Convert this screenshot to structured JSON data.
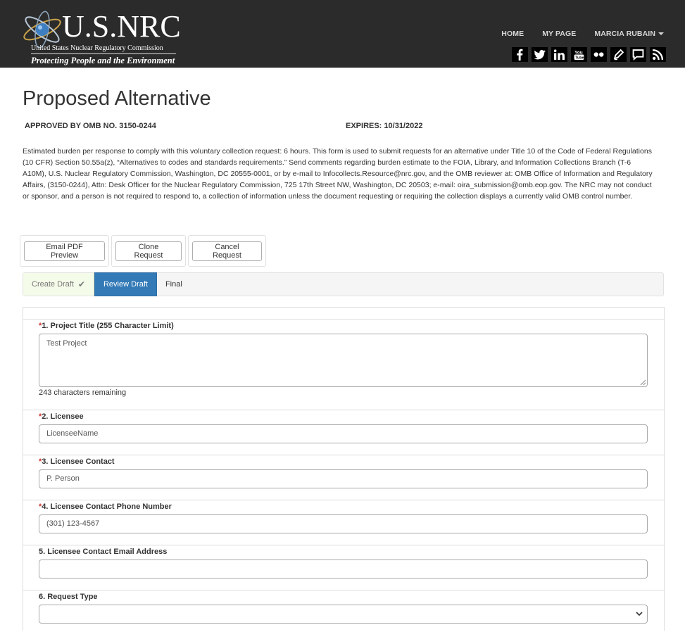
{
  "header": {
    "logo_name": "U.S.NRC",
    "logo_subtitle": "United States Nuclear Regulatory Commission",
    "logo_tagline": "Protecting People and the Environment",
    "nav": [
      "HOME",
      "MY PAGE",
      "MARCIA RUBAIN"
    ],
    "social_icons": [
      "facebook-icon",
      "twitter-icon",
      "linkedin-icon",
      "youtube-icon",
      "flickr-icon",
      "blog-icon",
      "chat-icon",
      "rss-icon"
    ]
  },
  "page": {
    "title": "Proposed Alternative",
    "omb": "APPROVED BY OMB NO. 3150-0244",
    "expires": "EXPIRES: 10/31/2022",
    "burden": "Estimated burden per response to comply with this voluntary collection request: 6 hours. This form is used to submit requests for an alternative under Title 10 of the Code of Federal Regulations (10 CFR) Section 50.55a(z), “Alternatives to codes and standards requirements.” Send comments regarding burden estimate to the FOIA, Library, and Information Collections Branch (T-6 A10M), U.S. Nuclear Regulatory Commission, Washington, DC 20555-0001, or by e-mail to Infocollects.Resource@nrc.gov, and the OMB reviewer at: OMB Office of Information and Regulatory Affairs, (3150-0244), Attn: Desk Officer for the Nuclear Regulatory Commission, 725 17th Street NW, Washington, DC 20503; e-mail: oira_submission@omb.eop.gov. The NRC may not conduct or sponsor, and a person is not required to respond to, a collection of information unless the document requesting or requiring the collection displays a currently valid OMB control number."
  },
  "actions": {
    "email_pdf": "Email PDF Preview",
    "clone": "Clone Request",
    "cancel": "Cancel Request"
  },
  "steps": {
    "create": "Create Draft",
    "review": "Review Draft",
    "final": "Final"
  },
  "form": {
    "required_mark": "*",
    "project_title": {
      "label": "1. Project Title (255 Character Limit)",
      "value": "Test Project",
      "remaining": "243 characters remaining"
    },
    "licensee": {
      "label": "2. Licensee",
      "value": "LicenseeName"
    },
    "licensee_contact": {
      "label": "3. Licensee Contact",
      "value": "P. Person"
    },
    "contact_phone": {
      "label": "4. Licensee Contact Phone Number",
      "value": "(301) 123-4567"
    },
    "contact_email": {
      "label": "5. Licensee Contact Email Address",
      "value": ""
    },
    "request_type": {
      "label": "6. Request Type",
      "value": ""
    }
  },
  "colors": {
    "header_bg": "#2b2b2b",
    "active_step": "#337ab7",
    "required": "#c9302c"
  }
}
